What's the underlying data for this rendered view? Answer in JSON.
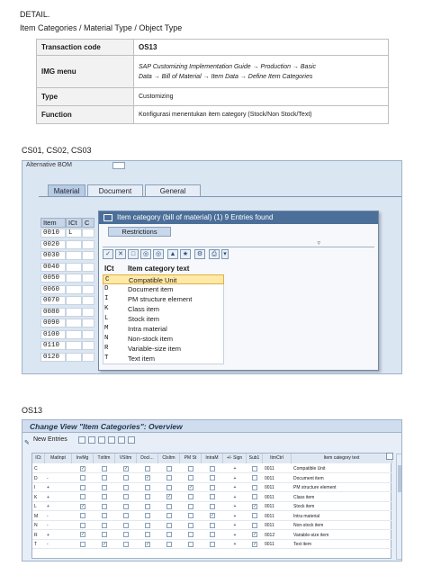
{
  "header": {
    "line1": "DETAIL.",
    "line2": "Item Categories / Material Type / Object Type"
  },
  "info_table": [
    {
      "key": "Transaction code",
      "value": "OS13"
    },
    {
      "key": "IMG menu",
      "value1": "SAP Customizing Implementation Guide → Production → Basic",
      "value2": "Data → Bill of Material → Item Data →  Define Item Categories"
    },
    {
      "key": "Type",
      "value": "Customizing"
    },
    {
      "key": "Function",
      "value": "Konfigurasi menentukan item category (Stock/Non Stock/Text)"
    }
  ],
  "section1_label": "CS01, CS02, CS03",
  "shot1": {
    "top_field": "Alternative BOM",
    "tabs": [
      "Material",
      "Document",
      "General"
    ],
    "grid_headers": [
      "Item",
      "ICt",
      "C"
    ],
    "rows": [
      {
        "item": "0010",
        "ict": "L"
      },
      {
        "item": "0020",
        "ict": ""
      },
      {
        "item": "0030",
        "ict": ""
      },
      {
        "item": "0040",
        "ict": ""
      },
      {
        "item": "0050",
        "ict": ""
      },
      {
        "item": "0060",
        "ict": ""
      },
      {
        "item": "0070",
        "ict": ""
      },
      {
        "item": "0080",
        "ict": ""
      },
      {
        "item": "0090",
        "ict": ""
      },
      {
        "item": "0100",
        "ict": ""
      },
      {
        "item": "0110",
        "ict": ""
      },
      {
        "item": "0120",
        "ict": ""
      }
    ],
    "popup": {
      "title": "Item category (bill of material) (1)   9 Entries found",
      "restrictions_tab": "Restrictions",
      "col_code": "ICt",
      "col_text": "Item category text",
      "entries": [
        {
          "code": "C",
          "text": "Compatible Unit",
          "selected": true
        },
        {
          "code": "D",
          "text": "Document item",
          "selected": false
        },
        {
          "code": "I",
          "text": "PM structure element",
          "selected": false
        },
        {
          "code": "K",
          "text": "Class item",
          "selected": false
        },
        {
          "code": "L",
          "text": "Stock item",
          "selected": false
        },
        {
          "code": "M",
          "text": "Intra material",
          "selected": false
        },
        {
          "code": "N",
          "text": "Non-stock item",
          "selected": false
        },
        {
          "code": "R",
          "text": "Variable-size item",
          "selected": false
        },
        {
          "code": "T",
          "text": "Text item",
          "selected": false
        }
      ]
    }
  },
  "section2_label": "OS13",
  "shot2": {
    "title": "Change View \"Item Categories\": Overview",
    "new_entries": "New Entries",
    "columns": [
      "ICt",
      "MatInpt",
      "InvMg",
      "TxtItm",
      "VSItm",
      "DocI...",
      "ClsItm",
      "PM St",
      "IntraM",
      "+/- Sign",
      "Sub1",
      "ItmCtrl",
      "Item category text"
    ],
    "rows": [
      {
        "ict": "C",
        "matinpt": "",
        "text": "Compatible Unit",
        "ctrl": "0011"
      },
      {
        "ict": "D",
        "matinpt": "-",
        "text": "Document item",
        "ctrl": "0011"
      },
      {
        "ict": "I",
        "matinpt": "+",
        "text": "PM structure element",
        "ctrl": "0011"
      },
      {
        "ict": "K",
        "matinpt": "+",
        "text": "Class item",
        "ctrl": "0011"
      },
      {
        "ict": "L",
        "matinpt": "+",
        "text": "Stock item",
        "ctrl": "0011"
      },
      {
        "ict": "M",
        "matinpt": "-",
        "text": "Intra material",
        "ctrl": "0011"
      },
      {
        "ict": "N",
        "matinpt": "-",
        "text": "Non-stock item",
        "ctrl": "0011"
      },
      {
        "ict": "R",
        "matinpt": "+",
        "text": "Variable-size item",
        "ctrl": "0012"
      },
      {
        "ict": "T",
        "matinpt": "-",
        "text": "Text item",
        "ctrl": "0011"
      }
    ]
  }
}
